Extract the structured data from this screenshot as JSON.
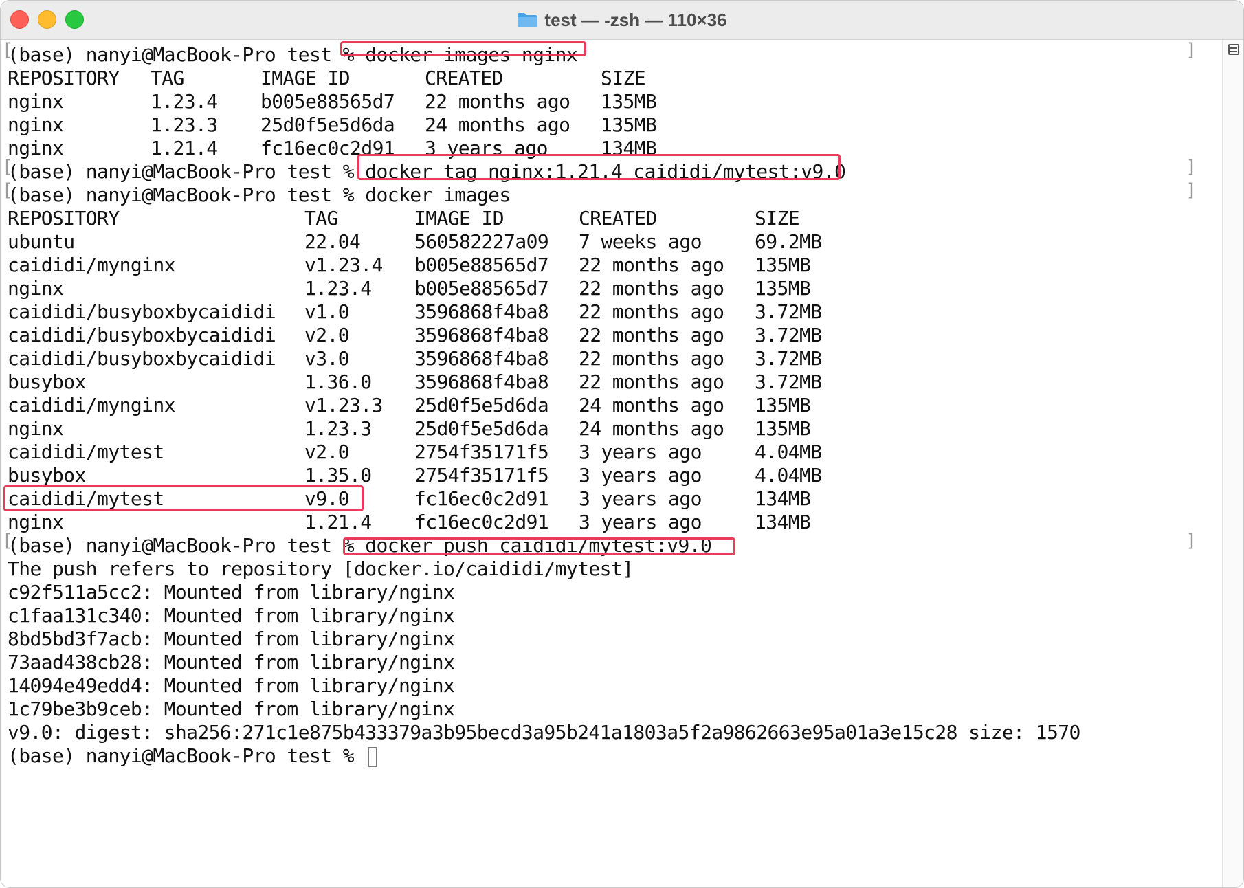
{
  "window": {
    "title": "test — -zsh — 110×36"
  },
  "terminal": {
    "prompt": "(base) nanyi@MacBook-Pro test % ",
    "cmd1": "docker images nginx",
    "table1": {
      "headers": [
        "REPOSITORY",
        "TAG",
        "IMAGE ID",
        "CREATED",
        "SIZE"
      ],
      "rows": [
        [
          "nginx",
          "1.23.4",
          "b005e88565d7",
          "22 months ago",
          "135MB"
        ],
        [
          "nginx",
          "1.23.3",
          "25d0f5e5d6da",
          "24 months ago",
          "135MB"
        ],
        [
          "nginx",
          "1.21.4",
          "fc16ec0c2d91",
          "3 years ago",
          "134MB"
        ]
      ]
    },
    "cmd2": "docker tag nginx:1.21.4 caididi/mytest:v9.0",
    "cmd3": "docker images",
    "table2": {
      "headers": [
        "REPOSITORY",
        "TAG",
        "IMAGE ID",
        "CREATED",
        "SIZE"
      ],
      "rows": [
        [
          "ubuntu",
          "22.04",
          "560582227a09",
          "7 weeks ago",
          "69.2MB"
        ],
        [
          "caididi/mynginx",
          "v1.23.4",
          "b005e88565d7",
          "22 months ago",
          "135MB"
        ],
        [
          "nginx",
          "1.23.4",
          "b005e88565d7",
          "22 months ago",
          "135MB"
        ],
        [
          "caididi/busyboxbycaididi",
          "v1.0",
          "3596868f4ba8",
          "22 months ago",
          "3.72MB"
        ],
        [
          "caididi/busyboxbycaididi",
          "v2.0",
          "3596868f4ba8",
          "22 months ago",
          "3.72MB"
        ],
        [
          "caididi/busyboxbycaididi",
          "v3.0",
          "3596868f4ba8",
          "22 months ago",
          "3.72MB"
        ],
        [
          "busybox",
          "1.36.0",
          "3596868f4ba8",
          "22 months ago",
          "3.72MB"
        ],
        [
          "caididi/mynginx",
          "v1.23.3",
          "25d0f5e5d6da",
          "24 months ago",
          "135MB"
        ],
        [
          "nginx",
          "1.23.3",
          "25d0f5e5d6da",
          "24 months ago",
          "135MB"
        ],
        [
          "caididi/mytest",
          "v2.0",
          "2754f35171f5",
          "3 years ago",
          "4.04MB"
        ],
        [
          "busybox",
          "1.35.0",
          "2754f35171f5",
          "3 years ago",
          "4.04MB"
        ],
        [
          "caididi/mytest",
          "v9.0",
          "fc16ec0c2d91",
          "3 years ago",
          "134MB"
        ],
        [
          "nginx",
          "1.21.4",
          "fc16ec0c2d91",
          "3 years ago",
          "134MB"
        ]
      ]
    },
    "cmd4": "docker push caididi/mytest:v9.0",
    "push_output": [
      "The push refers to repository [docker.io/caididi/mytest]",
      "c92f511a5cc2: Mounted from library/nginx",
      "c1faa131c340: Mounted from library/nginx",
      "8bd5bd3f7acb: Mounted from library/nginx",
      "73aad438cb28: Mounted from library/nginx",
      "14094e49edd4: Mounted from library/nginx",
      "1c79be3b9ceb: Mounted from library/nginx",
      "v9.0: digest: sha256:271c1e875b433379a3b95becd3a95b241a1803a5f2a9862663e95a01a3e15c28 size: 1570"
    ]
  },
  "colors": {
    "highlight": "#ea3b5a",
    "close": "#fe5f57",
    "minimize": "#febc2e",
    "zoom": "#28c840",
    "folder": "#4aa3e6"
  }
}
